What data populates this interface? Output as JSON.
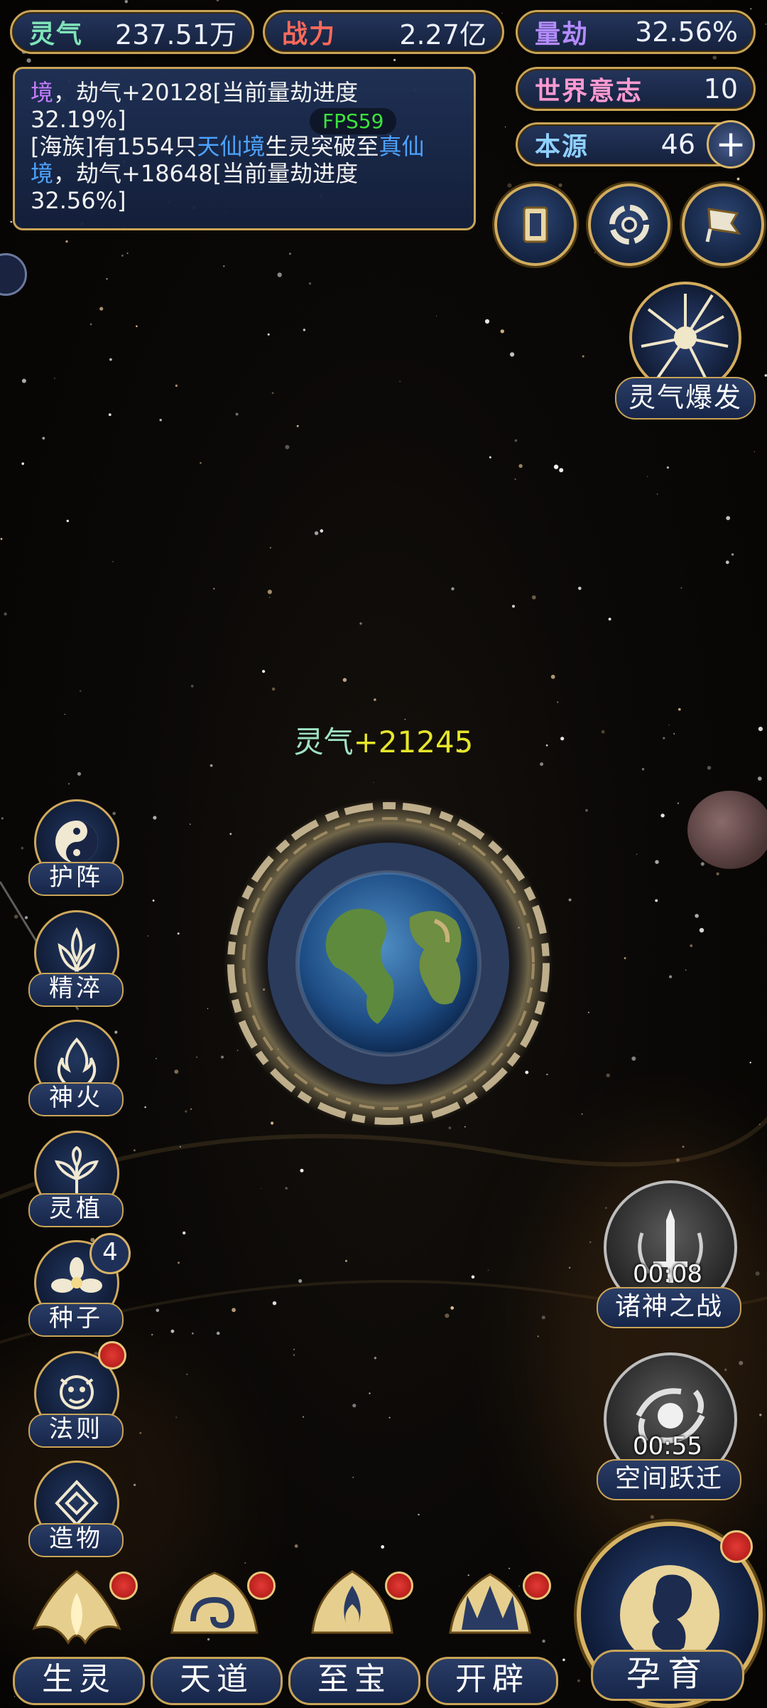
{
  "stats": {
    "lingqi": {
      "label": "灵气",
      "value": "237.51万"
    },
    "zhanli": {
      "label": "战力",
      "value": "2.27亿"
    },
    "liangjie": {
      "label": "量劫",
      "value": "32.56%"
    },
    "world_will": {
      "label": "世界意志",
      "value": "10"
    },
    "origin": {
      "label": "本源",
      "value": "46"
    }
  },
  "log": {
    "line1_realm": "境",
    "line1_rest": "，劫气+20128[当前量劫进度",
    "line2": "32.19%]",
    "line3_prefix": "[海族]有1554只",
    "line3_realm1": "天仙境",
    "line3_mid": "生灵突破至",
    "line3_realm2": "真仙",
    "line4_realm": "境",
    "line4_rest": "，劫气+18648[当前量劫进度",
    "line5": "32.56%]"
  },
  "fps": "FPS59",
  "lingqi_burst_label": "灵气爆发",
  "gain": {
    "prefix": "灵气",
    "amount": "+21245"
  },
  "side_menu": [
    {
      "label": "护阵"
    },
    {
      "label": "精淬"
    },
    {
      "label": "神火"
    },
    {
      "label": "灵植"
    },
    {
      "label": "种子",
      "badge": "4"
    },
    {
      "label": "法则"
    },
    {
      "label": "造物"
    }
  ],
  "events": [
    {
      "label": "诸神之战",
      "timer": "00:08"
    },
    {
      "label": "空间跃迁",
      "timer": "00:55"
    }
  ],
  "bottom_nav": [
    {
      "label": "生灵"
    },
    {
      "label": "天道"
    },
    {
      "label": "至宝"
    },
    {
      "label": "开辟"
    }
  ],
  "big_action": {
    "label": "孕育"
  },
  "colors": {
    "lingqi_label": "#7fe3b8",
    "zhanli_label": "#ff6a5a",
    "liangjie_label": "#b48cff",
    "world_will_label": "#ff9ad0",
    "origin_label": "#8fd0ff",
    "realm_purple": "#c77dff",
    "realm_blue": "#4da3ff",
    "gain_yellow": "#e6e62a",
    "gold_border": "#c9a457"
  }
}
